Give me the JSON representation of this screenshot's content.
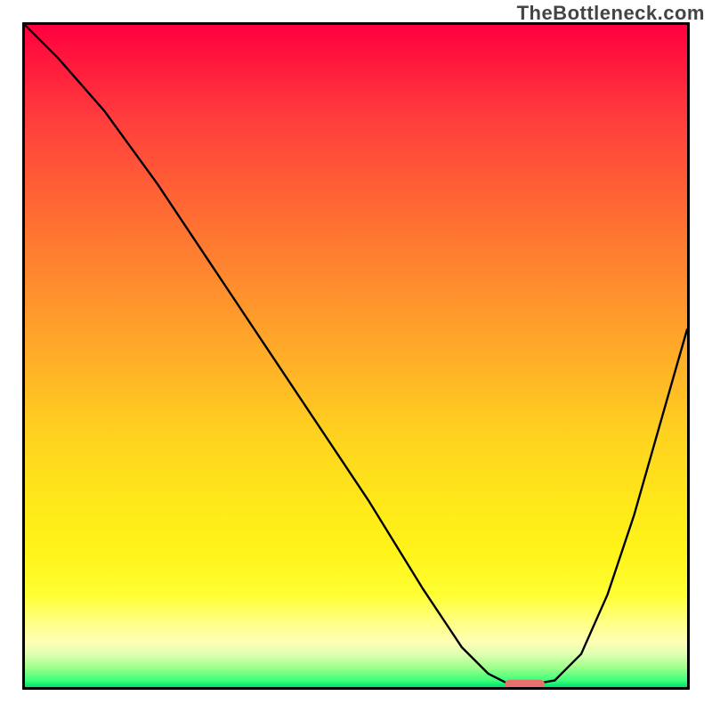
{
  "watermark": "TheBottleneck.com",
  "chart_data": {
    "type": "line",
    "title": "",
    "xlabel": "",
    "ylabel": "",
    "x_range": [
      0,
      100
    ],
    "y_range": [
      0,
      100
    ],
    "series": [
      {
        "name": "curve",
        "x": [
          0,
          5,
          12,
          20,
          28,
          36,
          44,
          52,
          60,
          66,
          70,
          73,
          77,
          80,
          84,
          88,
          92,
          96,
          100
        ],
        "y": [
          100,
          95,
          87,
          76,
          64,
          52,
          40,
          28,
          15,
          6,
          2,
          0.5,
          0.5,
          1,
          5,
          14,
          26,
          40,
          54
        ]
      }
    ],
    "marker": {
      "x": 75.5,
      "y": 0.5,
      "width": 6,
      "height": 1.2
    },
    "gradient_stops": [
      {
        "pos": 0,
        "color": "#ff0040"
      },
      {
        "pos": 14,
        "color": "#ff3d3d"
      },
      {
        "pos": 40,
        "color": "#ff8f2e"
      },
      {
        "pos": 72,
        "color": "#ffe81a"
      },
      {
        "pos": 90,
        "color": "#ffff80"
      },
      {
        "pos": 100,
        "color": "#00e070"
      }
    ]
  }
}
